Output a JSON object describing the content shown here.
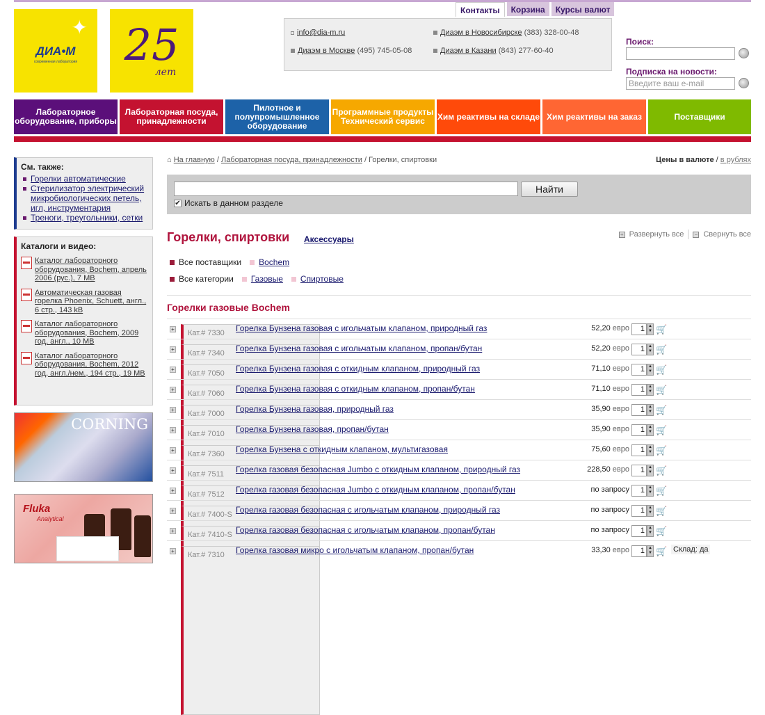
{
  "logos": {
    "main_brand": "ДИА•М",
    "main_sub": "современная лаборатория",
    "anniversary_num": "25",
    "anniversary_word": "лет"
  },
  "tabs": [
    {
      "label": "Контакты"
    },
    {
      "label": "Корзина"
    },
    {
      "label": "Курсы валют"
    }
  ],
  "contacts": {
    "email": "info@dia-m.ru",
    "moscow_link": "Диаэм в Москве",
    "moscow_phone": "(495) 745-05-08",
    "nsk_link": "Диаэм в Новосибирске",
    "nsk_phone": "(383) 328-00-48",
    "kazan_link": "Диаэм в Казани",
    "kazan_phone": "(843) 277-60-40"
  },
  "search": {
    "label": "Поиск:"
  },
  "subscribe": {
    "label": "Подписка на новости:",
    "placeholder": "Введите ваш e-mail"
  },
  "nav": [
    {
      "label": "Лабораторное оборудование, приборы",
      "color": "#5b0f7a"
    },
    {
      "label": "Лабораторная посуда, принадлежности",
      "color": "#c41230"
    },
    {
      "label": "Пилотное и полупромышленное оборудование",
      "color": "#1d62a8"
    },
    {
      "label": "Программные продукты Технический сервис",
      "color": "#f6a800"
    },
    {
      "label": "Хим реактивы на складе",
      "color": "#ff4a0a"
    },
    {
      "label": "Хим реактивы на заказ",
      "color": "#ff6633"
    },
    {
      "label": "Поставщики",
      "color": "#7fba00"
    }
  ],
  "see_also": {
    "title": "См. также:",
    "items": [
      "Горелки автоматические",
      "Стерилизатор электрический микробиологических петель, игл, инструментария",
      "Треноги, треугольники, сетки"
    ]
  },
  "catalogs": {
    "title": "Каталоги и видео:",
    "items": [
      "Каталог лабораторного оборудования, Bochem, апрель 2006 (рус.), 7 MB",
      "Автоматическая газовая горелка Phoenix, Schuett, англ., 6 стр., 143 kB",
      "Каталог лабораторного оборудования, Bochem, 2009 год, англ., 10 MB",
      "Каталог лабораторного оборудования, Bochem, 2012 год, англ./нем., 194 стр., 19 MB"
    ]
  },
  "banners": {
    "corning": "CORNING",
    "fluka": "Fluka",
    "fluka_sub": "Analytical"
  },
  "breadcrumb": {
    "home": "На главную",
    "sep": " / ",
    "section": "Лабораторная посуда, принадлежности",
    "current": "Горелки, спиртовки"
  },
  "currency": {
    "label": "Цены в валюте",
    "sep": " / ",
    "rub_link": "в рублях"
  },
  "search_bar": {
    "button": "Найти",
    "checkbox_label": "Искать в данном разделе"
  },
  "page": {
    "title": "Горелки, спиртовки",
    "accessories": "Аксессуары",
    "expand": "Развернуть все",
    "collapse": "Свернуть все"
  },
  "filters": {
    "all_suppliers": "Все поставщики",
    "supplier": "Bochem",
    "all_categories": "Все категории",
    "cat1": "Газовые",
    "cat2": "Спиртовые"
  },
  "group_title": "Горелки газовые Bochem",
  "products": [
    {
      "cat": "Кат.# 7330",
      "name": "Горелка Бунзена газовая с игольчатым клапаном, природный газ",
      "price": "52,20",
      "cur": "евро",
      "qty": "1"
    },
    {
      "cat": "Кат.# 7340",
      "name": "Горелка Бунзена газовая с игольчатым клапаном, пропан/бутан",
      "price": "52,20",
      "cur": "евро",
      "qty": "1"
    },
    {
      "cat": "Кат.# 7050",
      "name": "Горелка Бунзена газовая с откидным клапаном, природный газ",
      "price": "71,10",
      "cur": "евро",
      "qty": "1"
    },
    {
      "cat": "Кат.# 7060",
      "name": "Горелка Бунзена газовая с откидным клапаном, пропан/бутан",
      "price": "71,10",
      "cur": "евро",
      "qty": "1"
    },
    {
      "cat": "Кат.# 7000",
      "name": "Горелка Бунзена газовая, природный газ",
      "price": "35,90",
      "cur": "евро",
      "qty": "1"
    },
    {
      "cat": "Кат.# 7010",
      "name": "Горелка Бунзена газовая, пропан/бутан",
      "price": "35,90",
      "cur": "евро",
      "qty": "1"
    },
    {
      "cat": "Кат.# 7360",
      "name": "Горелка Бунзена с откидным клапаном, мультигазовая",
      "price": "75,60",
      "cur": "евро",
      "qty": "1"
    },
    {
      "cat": "Кат.# 7511",
      "name": "Горелка газовая безопасная Jumbo с откидным клапаном, природный газ",
      "price": "228,50",
      "cur": "евро",
      "qty": "1"
    },
    {
      "cat": "Кат.# 7512",
      "name": "Горелка газовая безопасная Jumbo с откидным клапаном, пропан/бутан",
      "price": "по запросу",
      "cur": "",
      "qty": "1"
    },
    {
      "cat": "Кат.# 7400-S",
      "name": "Горелка газовая безопасная с игольчатым клапаном, природный газ",
      "price": "по запросу",
      "cur": "",
      "qty": "1"
    },
    {
      "cat": "Кат.# 7410-S",
      "name": "Горелка газовая безопасная с игольчатым клапаном, пропан/бутан",
      "price": "по запросу",
      "cur": "",
      "qty": "1"
    },
    {
      "cat": "Кат.# 7310",
      "name": "Горелка газовая микро с игольчатым клапаном, пропан/бутан",
      "price": "33,30",
      "cur": "евро",
      "qty": "1",
      "stock": "Склад: да"
    }
  ]
}
